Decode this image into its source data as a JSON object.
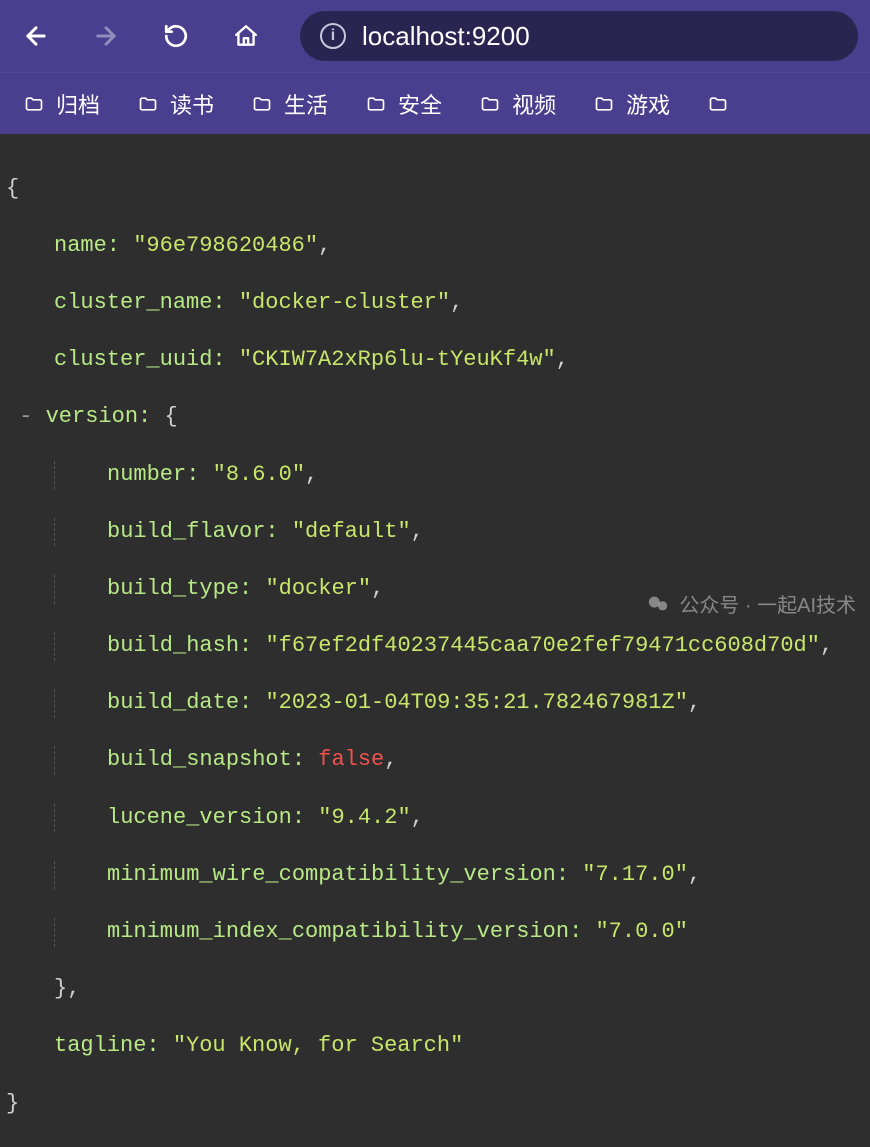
{
  "toolbar": {
    "url": "localhost:9200"
  },
  "bookmarks": [
    {
      "label": "归档"
    },
    {
      "label": "读书"
    },
    {
      "label": "生活"
    },
    {
      "label": "安全"
    },
    {
      "label": "视频"
    },
    {
      "label": "游戏"
    }
  ],
  "json": {
    "name": {
      "key": "name:",
      "value": "\"96e798620486\""
    },
    "cluster_name": {
      "key": "cluster_name:",
      "value": "\"docker-cluster\""
    },
    "cluster_uuid": {
      "key": "cluster_uuid:",
      "value": "\"CKIW7A2xRp6lu-tYeuKf4w\""
    },
    "version": {
      "key": "version:"
    },
    "number": {
      "key": "number:",
      "value": "\"8.6.0\""
    },
    "build_flavor": {
      "key": "build_flavor:",
      "value": "\"default\""
    },
    "build_type": {
      "key": "build_type:",
      "value": "\"docker\""
    },
    "build_hash": {
      "key": "build_hash:",
      "value": "\"f67ef2df40237445caa70e2fef79471cc608d70d\""
    },
    "build_date": {
      "key": "build_date:",
      "value": "\"2023-01-04T09:35:21.782467981Z\""
    },
    "build_snapshot": {
      "key": "build_snapshot:",
      "value": "false"
    },
    "lucene_version": {
      "key": "lucene_version:",
      "value": "\"9.4.2\""
    },
    "min_wire": {
      "key": "minimum_wire_compatibility_version:",
      "value": "\"7.17.0\""
    },
    "min_index": {
      "key": "minimum_index_compatibility_version:",
      "value": "\"7.0.0\""
    },
    "tagline": {
      "key": "tagline:",
      "value": "\"You Know, for Search\""
    }
  },
  "watermark": "公众号 · 一起AI技术"
}
